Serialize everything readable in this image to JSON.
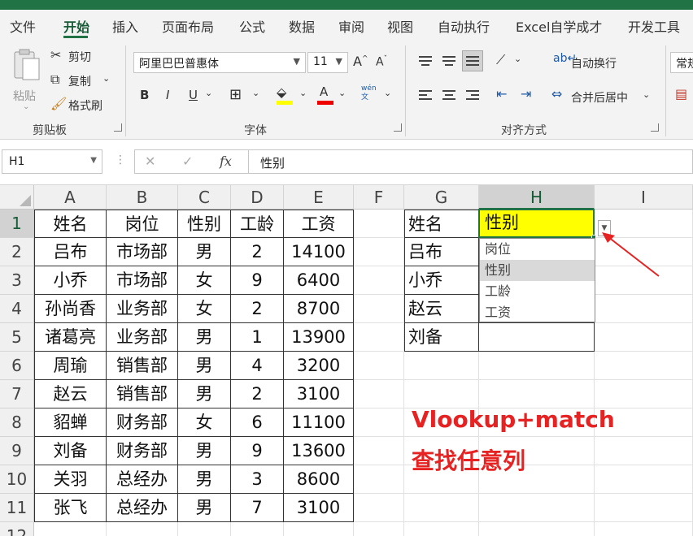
{
  "ribbon": {
    "tabs": [
      "文件",
      "开始",
      "插入",
      "页面布局",
      "公式",
      "数据",
      "审阅",
      "视图",
      "自动执行",
      "Excel自学成才",
      "开发工具"
    ],
    "active_tab": "开始",
    "clipboard": {
      "paste": "粘贴",
      "cut": "剪切",
      "copy": "复制",
      "format_painter": "格式刷",
      "group": "剪贴板"
    },
    "font": {
      "family": "阿里巴巴普惠体",
      "size": "11",
      "bold": "B",
      "italic": "I",
      "underline": "U",
      "phonetic": "wén\n文",
      "group": "字体"
    },
    "alignment": {
      "wrap": "自动换行",
      "merge": "合并后居中",
      "group": "对齐方式"
    },
    "number_format": "常规"
  },
  "formula_bar": {
    "name_box": "H1",
    "fx": "fx",
    "cancel": "✕",
    "enter": "✓",
    "content": "性别"
  },
  "columns": [
    "A",
    "B",
    "C",
    "D",
    "E",
    "F",
    "G",
    "H",
    "I"
  ],
  "rows": [
    "1",
    "2",
    "3",
    "4",
    "5",
    "6",
    "7",
    "8",
    "9",
    "10",
    "11",
    "12"
  ],
  "table": {
    "headers": [
      "姓名",
      "岗位",
      "性别",
      "工龄",
      "工资"
    ],
    "rows": [
      [
        "吕布",
        "市场部",
        "男",
        "2",
        "14100"
      ],
      [
        "小乔",
        "市场部",
        "女",
        "9",
        "6400"
      ],
      [
        "孙尚香",
        "业务部",
        "女",
        "2",
        "8700"
      ],
      [
        "诸葛亮",
        "业务部",
        "男",
        "1",
        "13900"
      ],
      [
        "周瑜",
        "销售部",
        "男",
        "4",
        "3200"
      ],
      [
        "赵云",
        "销售部",
        "男",
        "2",
        "3100"
      ],
      [
        "貂蝉",
        "财务部",
        "女",
        "6",
        "11100"
      ],
      [
        "刘备",
        "财务部",
        "男",
        "9",
        "13600"
      ],
      [
        "关羽",
        "总经办",
        "男",
        "3",
        "8600"
      ],
      [
        "张飞",
        "总经办",
        "男",
        "7",
        "3100"
      ]
    ]
  },
  "lookup": {
    "header_g": "姓名",
    "header_h": "性别",
    "names": [
      "吕布",
      "小乔",
      "赵云",
      "刘备"
    ]
  },
  "dropdown": {
    "options": [
      "岗位",
      "性别",
      "工龄",
      "工资"
    ],
    "highlighted": "性别"
  },
  "annotation": {
    "line1": "Vlookup+match",
    "line2": "查找任意列"
  },
  "colors": {
    "excel_green": "#217346",
    "highlight_yellow": "#ffff00",
    "annotation_red": "#e62222"
  }
}
